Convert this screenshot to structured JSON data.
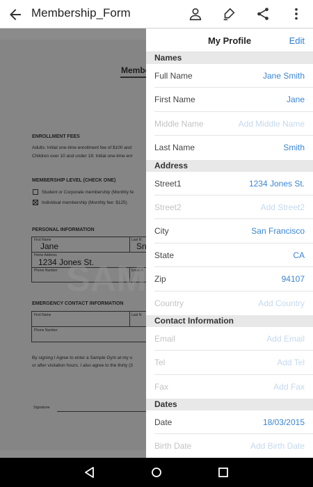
{
  "appbar": {
    "title": "Membership_Form"
  },
  "document": {
    "heading": "Membe",
    "enroll_title": "ENROLLMENT FEES",
    "enroll_line1": "Adults: Initial one-time enrollment fee of $100 and",
    "enroll_line2": "Children over 10 and under 18: Initial one-time enr",
    "level_title": "MEMBERSHIP LEVEL (CHECK ONE)",
    "level_opt1": "Student or Corporate membership (Monthly fe",
    "level_opt2": "Individual membership (Monthly fee: $125)",
    "personal_title": "PERSONAL INFORMATION",
    "first_name_label": "First Name",
    "first_name_value": "Jane",
    "last_name_label": "Last N",
    "last_name_value": "Sn",
    "home_address_label": "Home Address",
    "home_address_value": "1234 Jones St.",
    "phone_label": "Phone Number",
    "email_label": "Email A",
    "emergency_title": "EMERGENCY CONTACT INFORMATION",
    "em_first_label": "First Name",
    "em_last_label": "Last N",
    "em_phone_label": "Phone Number",
    "agree_line1": "By signing I Agree to enter a Sample Gym at my o",
    "agree_line2": "or after visitation hours. I also agree to the thirty (3",
    "signature_label": "Signature",
    "watermark": "SAM"
  },
  "panel": {
    "title": "My Profile",
    "edit_label": "Edit",
    "sections": {
      "names": "Names",
      "address": "Address",
      "contact": "Contact Information",
      "dates": "Dates"
    },
    "fields": {
      "full_name": {
        "label": "Full Name",
        "value": "Jane Smith"
      },
      "first_name": {
        "label": "First Name",
        "value": "Jane"
      },
      "middle_name": {
        "label": "Middle Name",
        "value": "Add Middle Name"
      },
      "last_name": {
        "label": "Last Name",
        "value": "Smith"
      },
      "street1": {
        "label": "Street1",
        "value": "1234 Jones St."
      },
      "street2": {
        "label": "Street2",
        "value": "Add Street2"
      },
      "city": {
        "label": "City",
        "value": "San Francisco"
      },
      "state": {
        "label": "State",
        "value": "CA"
      },
      "zip": {
        "label": "Zip",
        "value": "94107"
      },
      "country": {
        "label": "Country",
        "value": "Add Country"
      },
      "email": {
        "label": "Email",
        "value": "Add Email"
      },
      "tel": {
        "label": "Tel",
        "value": "Add Tel"
      },
      "fax": {
        "label": "Fax",
        "value": "Add Fax"
      },
      "date": {
        "label": "Date",
        "value": "18/03/2015"
      },
      "birth_date": {
        "label": "Birth Date",
        "value": "Add Birth Date"
      }
    }
  },
  "icons": {
    "back": "arrow-back-icon",
    "profile": "person-icon",
    "sign": "pen-icon",
    "share": "share-icon",
    "more": "more-vert-icon"
  },
  "colors": {
    "accent": "#3a86d1",
    "placeholder": "#c5d9ee",
    "section_bg": "#e8e8e8"
  }
}
